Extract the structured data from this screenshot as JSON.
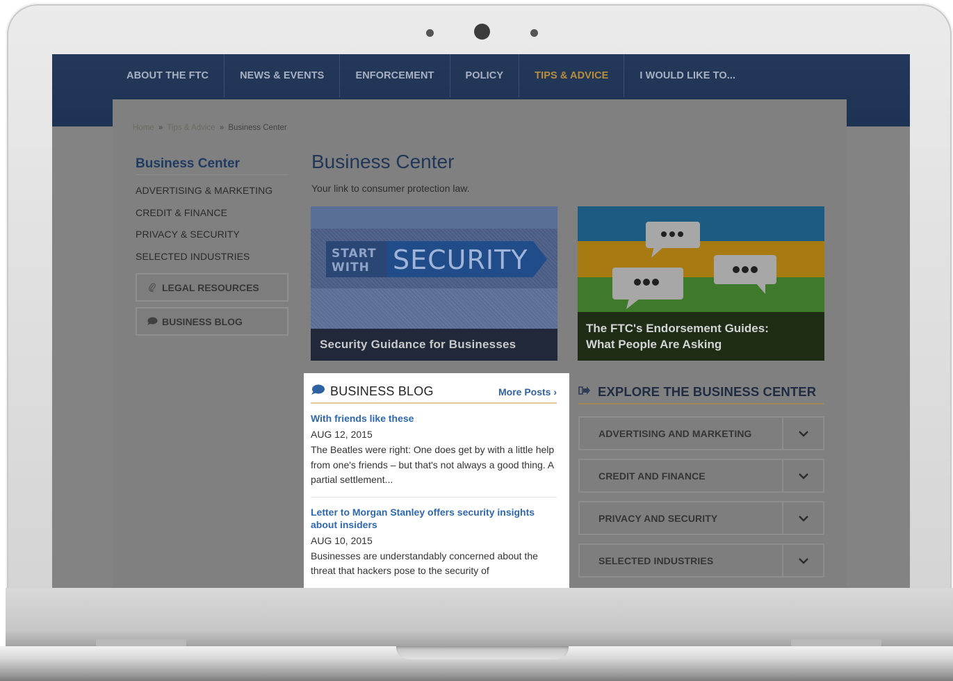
{
  "nav": {
    "items": [
      {
        "label": "ABOUT THE FTC",
        "active": false
      },
      {
        "label": "NEWS & EVENTS",
        "active": false
      },
      {
        "label": "ENFORCEMENT",
        "active": false
      },
      {
        "label": "POLICY",
        "active": false
      },
      {
        "label": "TIPS & ADVICE",
        "active": true
      },
      {
        "label": "I WOULD LIKE TO...",
        "active": false
      }
    ]
  },
  "breadcrumb": {
    "home": "Home",
    "parent": "Tips & Advice",
    "current": "Business Center",
    "separator": "»"
  },
  "sidebar": {
    "title": "Business Center",
    "links": [
      "ADVERTISING & MARKETING",
      "CREDIT & FINANCE",
      "PRIVACY & SECURITY",
      "SELECTED INDUSTRIES"
    ],
    "legal_resources": "LEGAL RESOURCES",
    "business_blog": "BUSINESS BLOG"
  },
  "main": {
    "title": "Business Center",
    "subtitle": "Your link to consumer protection law.",
    "feature1": {
      "banner_small_1": "START",
      "banner_small_2": "WITH",
      "banner_big": "SECURITY",
      "caption": "Security Guidance for Businesses"
    },
    "feature2": {
      "caption_line1": "The FTC's Endorsement Guides:",
      "caption_line2": "What People Are Asking"
    }
  },
  "blog": {
    "title": "BUSINESS BLOG",
    "more_posts": "More Posts ›",
    "posts": [
      {
        "title": "With friends like these",
        "date": "AUG 12, 2015",
        "excerpt": "The Beatles were right: One does get by with a little help from one's friends – but that's not always a good thing. A partial settlement..."
      },
      {
        "title": "Letter to Morgan Stanley offers security insights about insiders",
        "date": "AUG 10, 2015",
        "excerpt": "Businesses are understandably concerned about the threat that hackers pose to the security of"
      }
    ]
  },
  "explore": {
    "title": "EXPLORE THE BUSINESS CENTER",
    "items": [
      "ADVERTISING AND MARKETING",
      "CREDIT AND FINANCE",
      "PRIVACY AND SECURITY",
      "SELECTED INDUSTRIES"
    ]
  },
  "colors": {
    "nav_bg": "#1e3253",
    "nav_active": "#b88e3c",
    "link_blue": "#2f68ac",
    "heading_navy": "#1f3b63"
  }
}
